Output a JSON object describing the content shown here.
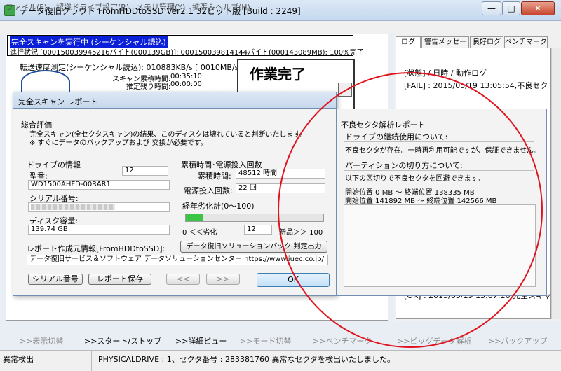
{
  "window": {
    "title": "データ復旧クラウド FromHDDtoSSD Ver2.1 32ビット版 [Build : 2249]",
    "minimize": "—",
    "maximize": "□",
    "close": "✕"
  },
  "menu": [
    "ファイル(F)",
    "認識ドライブ設定(R)",
    "メモリ管理(Y)",
    "拡張＆ヘルプ(H)"
  ],
  "status": {
    "mode": "完全スキャンを実行中 (シーケンシャル読込)",
    "progress": "進行状況 [000150039945216バイト(000139GB)]: 000150039814144バイト(000143089MB): 100%完了",
    "speed": "転送速度測定(シーケンシャル読込): 010883KB/s [ 0010MB/s ]",
    "scan_time_label": "スキャン累積時間:",
    "scan_time_value": "00:35:10",
    "remain_label": "推定残り時間:",
    "remain_value": "00:00:00",
    "complete": "作業完了"
  },
  "tabs": [
    "ログ",
    "警告メッセージ",
    "良好ログ",
    "ベンチマーク"
  ],
  "log": {
    "header": "[状態] / 日時 / 動作ログ",
    "fail": "[FAIL] : 2015/05/19 13:05:54,不良セク",
    "ok": "[OK] : 2015/05/19 13:07:16,完全スキャ"
  },
  "dialog": {
    "title": "完全スキャン レポート",
    "overall_title": "総合評価",
    "overall_text1": "完全スキャン(全セクタスキャン)の結果、このディスクは壊れていると判断いたします。",
    "overall_text2": "※ すぐにデータのバックアップおよび 交換が必要です。",
    "drive_title": "ドライブの情報",
    "drive_count": "12",
    "model_label": "型番:",
    "model_value": "WD1500AHFD-00RAR1",
    "serial_label": "シリアル番号:",
    "capacity_label": "ディスク容量:",
    "capacity_value": "139.74 GB",
    "hours_title": "累積時間･電源投入回数",
    "hours_label": "累積時間:",
    "hours_value": "48512 時間",
    "power_label": "電源投入回数:",
    "power_value": "22 回",
    "degradation_title": "経年劣化計(0～100)",
    "degradation_value": 12,
    "deg_min": "0 ＜＜劣化",
    "deg_value_text": "12",
    "deg_max": "新品＞＞ 100",
    "creator_label": "レポート作成元情報[FromHDDtoSSD]:",
    "solution_button": "データ復旧ソリューションパック 判定出力",
    "creator_value": "データ復旧サービス＆ソフトウェア データソリューションセンター https://www.iuec.co.jp/",
    "serial_button": "シリアル番号",
    "save_button": "レポート保存",
    "prev_button": "<<",
    "next_button": ">>",
    "ok_button": "OK",
    "bad_title": "不良セクタ解析レポート",
    "continue_title": "ドライブの継続使用について:",
    "continue_text": "不良セクタが存在。一時再利用可能ですが、保証できません。",
    "partition_title": "パーティションの切り方について:",
    "partition_text": "以下の区切りで不良セクタを回避できます。",
    "range1": "開始位置 0 MB ～ 終端位置 138335 MB",
    "range2": "開始位置 141892 MB ～ 終端位置 142566 MB"
  },
  "nav": [
    ">>表示切替",
    ">>スタート/ストップ",
    ">>詳細ビュー",
    ">>モード切替",
    ">>ベンチマーク",
    ">>ビッグデータ解析",
    ">>バックアップ"
  ],
  "statusbar": {
    "left": "異常検出",
    "message": "PHYSICALDRIVE : 1、セクタ番号 : 283381760 異常なセクタを検出いたしました。"
  },
  "colors": {
    "accent_blue": "#0a1fd8",
    "progress_green": "#3cc446",
    "annotation_red": "#e0141e"
  }
}
